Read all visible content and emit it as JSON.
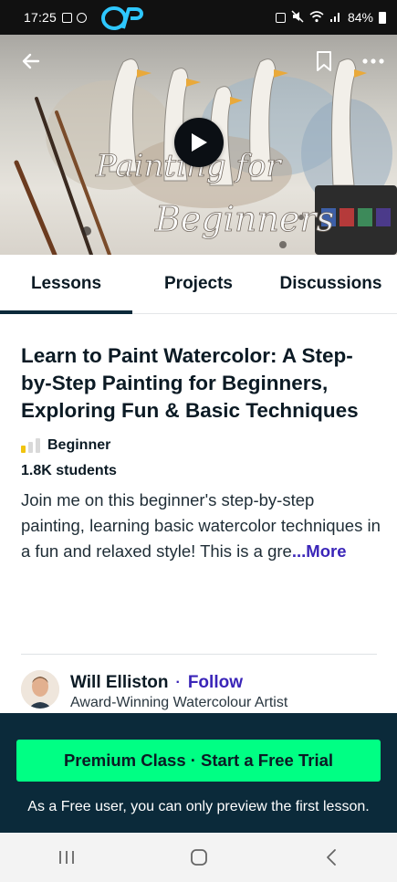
{
  "status_bar": {
    "time": "17:25",
    "battery": "84%",
    "icons": [
      "media-icon",
      "image-icon",
      "whatsapp-icon",
      "app-logo-icon",
      "nfc-icon",
      "mute-icon",
      "wifi-icon",
      "signal-icon",
      "battery-icon"
    ]
  },
  "hero": {
    "overlay_text_line1": "Painting for",
    "overlay_text_line2": "Beginners",
    "icons": {
      "back": "arrow-left-icon",
      "bookmark": "bookmark-icon",
      "more": "more-dots-icon",
      "play": "play-icon"
    }
  },
  "tabs": [
    {
      "label": "Lessons",
      "active": true
    },
    {
      "label": "Projects",
      "active": false
    },
    {
      "label": "Discussions",
      "active": false
    }
  ],
  "course": {
    "title": "Learn to Paint Watercolor: A Step-by-Step Painting for Beginners, Exploring Fun & Basic Techniques",
    "level": "Beginner",
    "students": "1.8K students",
    "description": "Join me on this beginner's step-by-step painting, learning basic watercolor techniques in a fun and relaxed style! This is a gre",
    "more_label": "...More"
  },
  "teacher": {
    "name": "Will Elliston",
    "separator": "·",
    "follow_label": "Follow",
    "role": "Award-Winning Watercolour Artist"
  },
  "cta": {
    "button_label": "Premium Class · Start a Free Trial",
    "note": "As a Free user, you can only preview the first lesson."
  },
  "colors": {
    "dark": "#0b2a3a",
    "accent_green": "#00ff84",
    "link_purple": "#3a25b8",
    "level_yellow": "#f1c40f"
  },
  "nav": [
    "recent-apps-icon",
    "home-icon",
    "back-icon"
  ]
}
